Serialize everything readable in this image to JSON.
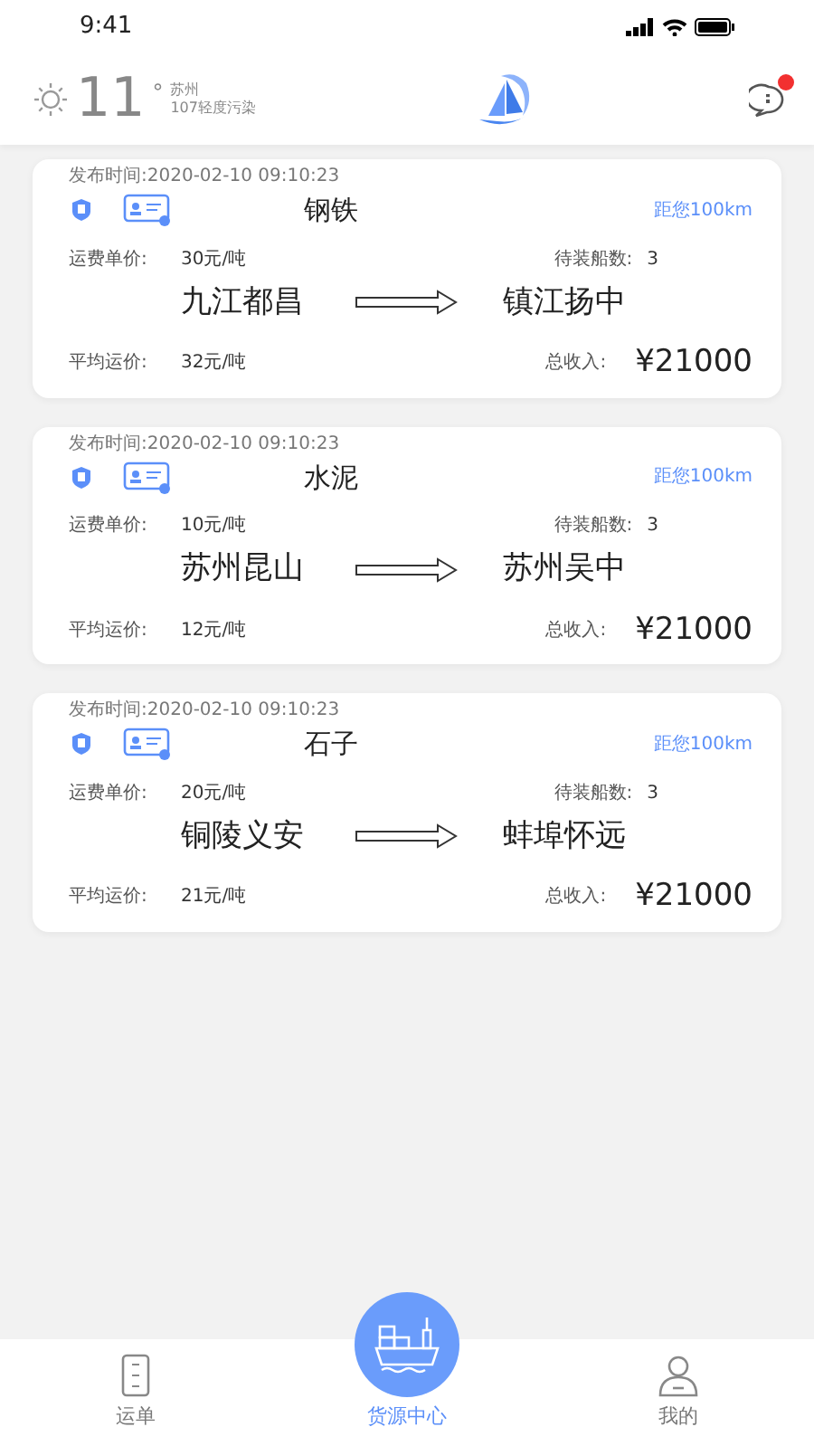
{
  "status_bar": {
    "time": "9:41"
  },
  "weather": {
    "temperature": "11",
    "degree": "°",
    "city": "苏州",
    "air_quality": "107轻度污染"
  },
  "messages": {
    "unread": true
  },
  "cargo_list": [
    {
      "published": "发布时间:2020-02-10 09:10:23",
      "cargo": "钢铁",
      "distance": "距您100km",
      "freight_label": "运费单价:",
      "freight": "30元/吨",
      "ships_label": "待装船数:",
      "ships": "3",
      "origin": "九江都昌",
      "destination": "镇江扬中",
      "avg_label": "平均运价:",
      "avg": "32元/吨",
      "income_label": "总收入:",
      "income": "¥21000"
    },
    {
      "published": "发布时间:2020-02-10 09:10:23",
      "cargo": "水泥",
      "distance": "距您100km",
      "freight_label": "运费单价:",
      "freight": "10元/吨",
      "ships_label": "待装船数:",
      "ships": "3",
      "origin": "苏州昆山",
      "destination": "苏州吴中",
      "avg_label": "平均运价:",
      "avg": "12元/吨",
      "income_label": "总收入:",
      "income": "¥21000"
    },
    {
      "published": "发布时间:2020-02-10 09:10:23",
      "cargo": "石子",
      "distance": "距您100km",
      "freight_label": "运费单价:",
      "freight": "20元/吨",
      "ships_label": "待装船数:",
      "ships": "3",
      "origin": "铜陵义安",
      "destination": "蚌埠怀远",
      "avg_label": "平均运价:",
      "avg": "21元/吨",
      "income_label": "总收入:",
      "income": "¥21000"
    }
  ],
  "tab_bar": [
    {
      "kind": "waybill",
      "label": "运单",
      "selected": false
    },
    {
      "kind": "cargo",
      "label": "货源中心",
      "selected": true
    },
    {
      "kind": "profile",
      "label": "我的",
      "selected": false
    }
  ]
}
